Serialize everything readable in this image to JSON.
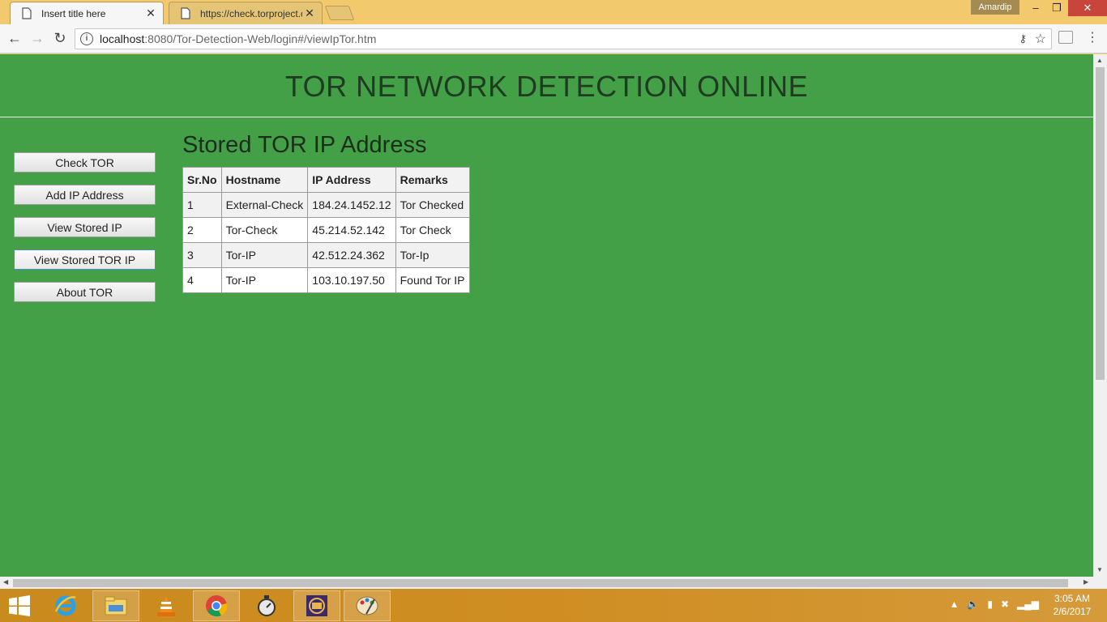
{
  "browser": {
    "tabs": [
      {
        "label": "Insert title here",
        "active": true
      },
      {
        "label": "https://check.torproject.o",
        "active": false
      }
    ],
    "profile_name": "Amardip",
    "url_host": "localhost",
    "url_path": ":8080/Tor-Detection-Web/login#/viewIpTor.htm"
  },
  "page": {
    "site_title": "TOR NETWORK DETECTION ONLINE",
    "heading": "Stored TOR IP Address",
    "nav": [
      {
        "label": "Check TOR"
      },
      {
        "label": "Add IP Address"
      },
      {
        "label": "View Stored IP"
      },
      {
        "label": "View Stored TOR IP",
        "selected": true
      },
      {
        "label": "About TOR"
      }
    ],
    "table": {
      "headers": [
        "Sr.No",
        "Hostname",
        "IP Address",
        "Remarks"
      ],
      "rows": [
        [
          "1",
          "External-Check",
          "184.24.1452.12",
          "Tor Checked"
        ],
        [
          "2",
          "Tor-Check",
          "45.214.52.142",
          "Tor Check"
        ],
        [
          "3",
          "Tor-IP",
          "42.512.24.362",
          "Tor-Ip"
        ],
        [
          "4",
          "Tor-IP",
          "103.10.197.50",
          "Found Tor IP"
        ]
      ]
    }
  },
  "taskbar": {
    "clock_time": "3:05 AM",
    "clock_date": "2/6/2017",
    "apps": [
      "internet-explorer",
      "file-explorer",
      "vlc",
      "chrome",
      "stopwatch",
      "java-ee-ide",
      "paint"
    ]
  },
  "colors": {
    "page_bg": "#43a047",
    "titlebar_bg": "#f2c96c",
    "close_button": "#c7453b"
  }
}
